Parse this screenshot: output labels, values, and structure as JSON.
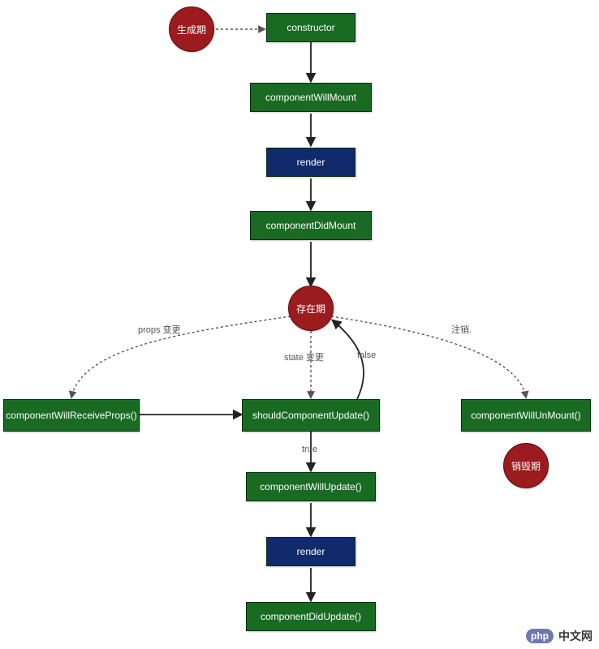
{
  "phases": {
    "creation": "生成期",
    "existence": "存在期",
    "destruction": "销毁期"
  },
  "lifecycle": {
    "constructor": "constructor",
    "componentWillMount": "componentWillMount",
    "render": "render",
    "componentDidMount": "componentDidMount",
    "componentWillReceiveProps": "componentWillReceiveProps()",
    "shouldComponentUpdate": "shouldComponentUpdate()",
    "componentWillUpdate": "componentWillUpdate()",
    "componentDidUpdate": "componentDidUpdate()",
    "componentWillUnMount": "componentWillUnMount()"
  },
  "labels": {
    "propsChange": "props 变更",
    "stateChange": "state 变更",
    "trueLabel": "true",
    "falseLabel": "false",
    "unregister": "注销."
  },
  "branding": {
    "logo": "php",
    "site": "中文网"
  }
}
